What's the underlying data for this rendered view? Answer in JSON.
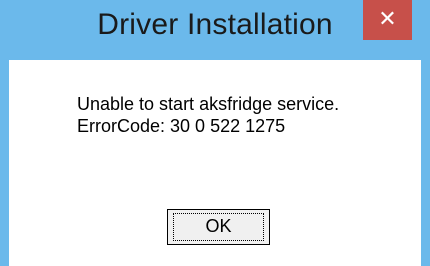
{
  "window": {
    "title": "Driver Installation",
    "close_glyph": "✕",
    "close_icon": "close-icon",
    "titlebar_color": "#6bb9eb",
    "close_button_color": "#c7504a"
  },
  "message": {
    "line1": "Unable to start aksfridge service.",
    "line2": "ErrorCode: 30 0 522 1275"
  },
  "buttons": {
    "ok_label": "OK"
  }
}
